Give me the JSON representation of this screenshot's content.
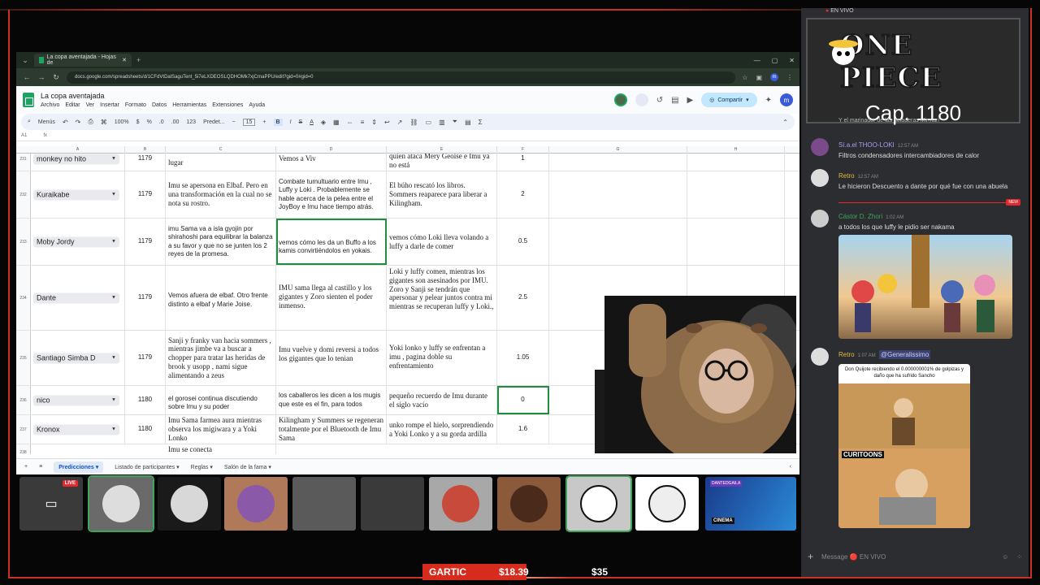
{
  "browser": {
    "tab_title": "La copa aventajada - Hojas de",
    "url": "docs.google.com/spreadsheets/d/1CFdVtDalSaguTent_5i7eLXDEOSLQDHOMk7xjCrnaPPU/edit?gid=0#gid=0"
  },
  "sheet": {
    "title": "La copa aventajada",
    "menus": [
      "Archivo",
      "Editar",
      "Ver",
      "Insertar",
      "Formato",
      "Datos",
      "Herramientas",
      "Extensiones",
      "Ayuda"
    ],
    "share_label": "Compartir",
    "account_initial": "m",
    "toolbar": {
      "menus_label": "Menús",
      "zoom": "100%",
      "currency": "$",
      "percent": "%",
      "decimals_dec": ".0",
      "decimals_inc": ".00",
      "number_fmt": "123",
      "font": "Predet...",
      "font_size": "15",
      "bold": "B",
      "italic": "I",
      "strike": "S",
      "text_color": "A"
    },
    "name_box": "A1",
    "fx": "fx",
    "columns": [
      "A",
      "B",
      "C",
      "D",
      "E",
      "F",
      "G",
      "H"
    ],
    "rows": [
      {
        "n": "231",
        "name": "monkey no hito",
        "cap": "1179",
        "c": "lugar",
        "d": "Vemos a Viv",
        "e": "quien ataca Mery Geoise e Imu ya no está",
        "f": "1"
      },
      {
        "n": "232",
        "name": "Kuraikabe",
        "cap": "1179",
        "c": "Imu se apersona en Elbaf. Pero en una transformación en la cual no se nota su rostro.",
        "d": "Combate tumultuario entre Imu , Luffy y Loki . Probablemente se hable acerca de la pelea entre el JoyBoy e Imu hace tiempo atrás.",
        "e": "El búho rescató los libros. Sommers reaparece para liberar a Kilingham.",
        "f": "2"
      },
      {
        "n": "233",
        "name": "Moby Jordy",
        "cap": "1179",
        "c": "imu Sama va a isla gyojin por shirahoshi para equilibrar la balanza a su favor y que no se junten los 2 reyes de la promesa.",
        "d": "vemos cómo les da un Buffo a los kamis convirtiéndolos en yokais.",
        "e": "vemos cómo Loki lleva volando a luffy a darle de comer",
        "f": "0.5"
      },
      {
        "n": "234",
        "name": "Dante",
        "cap": "1179",
        "c": "Vemos afuera de elbaf. Otro frente distinto a elbaf y Marie Joise.",
        "d": "IMU sama llega al castillo y los gigantes y Zoro sienten el poder inmenso.",
        "e": "Loki y luffy comen, mientras los gigantes son asesinados por IMU. Zoro y Sanji se tendrán que apersonar y pelear juntos contra mi mientras se recuperan luffy y Loki.,",
        "f": "2.5"
      },
      {
        "n": "235",
        "name": "Santiago Simba D",
        "cap": "1179",
        "c": "Sanji y franky van hacia sommers , mientras jimbe va a buscar a chopper para tratar las heridas de brook y usopp , nami sigue alimentando a zeus",
        "d": "Imu vuelve y domi reversi a todos los gigantes que lo tenian",
        "e": "Yoki lonko y luffy se enfrentan a imu , pagina doble su enfrentamiento",
        "f": "1.05"
      },
      {
        "n": "236",
        "name": "nico",
        "cap": "1180",
        "c": "el gorosei continua discutiendo sobre Imu y su poder",
        "d": "los caballeros les dicen a los mugis que este es el fin, para todos",
        "e": "pequeño recuerdo de Imu durante el siglo vacío",
        "f": "0"
      },
      {
        "n": "237",
        "name": "Kronox",
        "cap": "1180",
        "c": "Imu Sama farmea aura mientras observa los migiwara y a Yoki Lonko",
        "d": "Kilingham y Summers se regeneran totalmente por el Bluetooth de Imu Sama",
        "e": "unko rompe el hielo, sorprendiendo a Yoki Lonko y a su gorda ardilla",
        "f": "1.6"
      },
      {
        "n": "238",
        "name": "",
        "cap": "",
        "c": "Imu se conecta",
        "d": "",
        "e": "",
        "f": ""
      }
    ],
    "sheet_tabs": [
      "Predicciones",
      "Listado de participantes",
      "Reglas",
      "Salón de la fama"
    ]
  },
  "chat": {
    "live_label": "EN VIVO",
    "title_art": "ONE PIECE",
    "chapter": "Cap. 1180",
    "clipped_line": "Y el marinador de las heladeras Mirman",
    "messages": [
      {
        "user": "Sí.a.el THOO-LOKI",
        "time": "12:57 AM",
        "text": "Filtros condensadores intercambiadores de calor",
        "color": "#a99cf0"
      },
      {
        "user": "Retro",
        "time": "12:57 AM",
        "text": "Le hicieron Descuento a dante por qué fue con una abuela",
        "color": "#e6b93a"
      },
      {
        "user": "Cástor D. Zhori",
        "time": "1:02 AM",
        "text": "a todos los que luffy le pidio ser nakama",
        "color": "#3ba55c",
        "badge": "NEW"
      },
      {
        "user": "Retro",
        "time": "1:07 AM",
        "text": "@Generalissimo",
        "color": "#e6b93a"
      }
    ],
    "meme_caption": "Don Quijote recibiendo el 0.000000001% de golpizas y daño que ha sufrido Sancho",
    "meme_logo": "CURITOONS",
    "input_placeholder": "Message 🔴 EN VIVO"
  },
  "participants": {
    "live_badge": "LIVE",
    "cinema_label": "CINEMA",
    "stream_label": "DANTEDGAILA"
  },
  "bottom": {
    "gartic_label": "GARTIC",
    "amount1": "$18.39",
    "amount2": "$35"
  },
  "colors": {
    "accent_red": "#c8321e",
    "sheets_green": "#1ea362",
    "selection_green": "#1e8e3e"
  }
}
